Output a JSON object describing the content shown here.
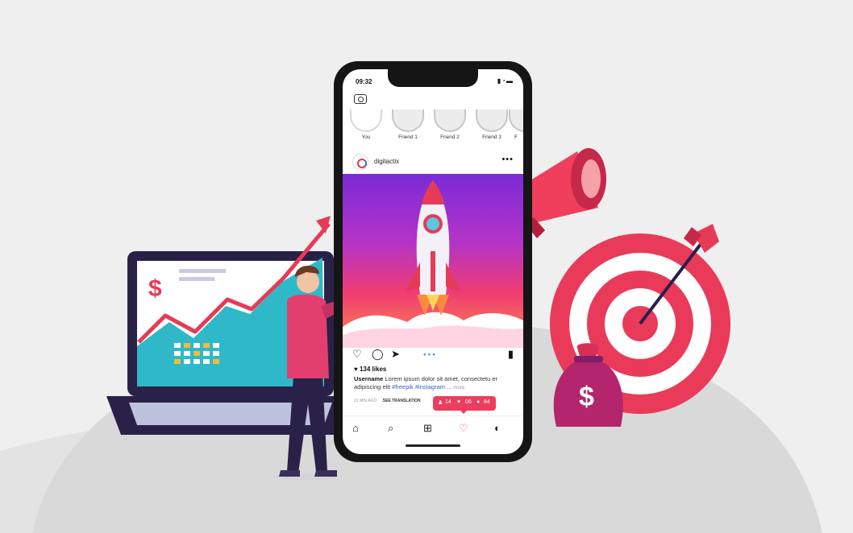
{
  "colors": {
    "background": "#efefef",
    "accent": "#ec3d5d",
    "laptop_screen": "#2fb9c8",
    "phone_body": "#151515"
  },
  "phone": {
    "status_time": "09:32",
    "status_icons": "signal-wifi-battery",
    "stories": [
      {
        "label": "You"
      },
      {
        "label": "Friend 1"
      },
      {
        "label": "Friend 2"
      },
      {
        "label": "Friend 3"
      },
      {
        "label": "F"
      }
    ],
    "post": {
      "handle": "digitactix",
      "likes": "134 likes",
      "caption_user": "Username",
      "caption_text": "Lorem ipsum dolor sit amet, consectetu er adipiscing elit",
      "caption_tags": "#freepik #instagram ...",
      "caption_more": "more",
      "timestamp": "21 MIN AGO",
      "see_translation": "SEE TRANSLATION"
    },
    "notifications": {
      "followers": "14",
      "likes": "06",
      "comments": "84"
    },
    "icons": {
      "camera": "camera-icon",
      "more": "more-options-icon",
      "like": "heart-outline-icon",
      "comment": "comment-icon",
      "share": "send-icon",
      "save": "bookmark-icon",
      "home": "home-icon",
      "search": "search-icon",
      "add": "add-post-icon",
      "activity": "heart-icon",
      "profile": "profile-icon"
    }
  },
  "laptop": {
    "currency_symbol": "$"
  },
  "money_bag": {
    "currency_symbol": "$"
  }
}
